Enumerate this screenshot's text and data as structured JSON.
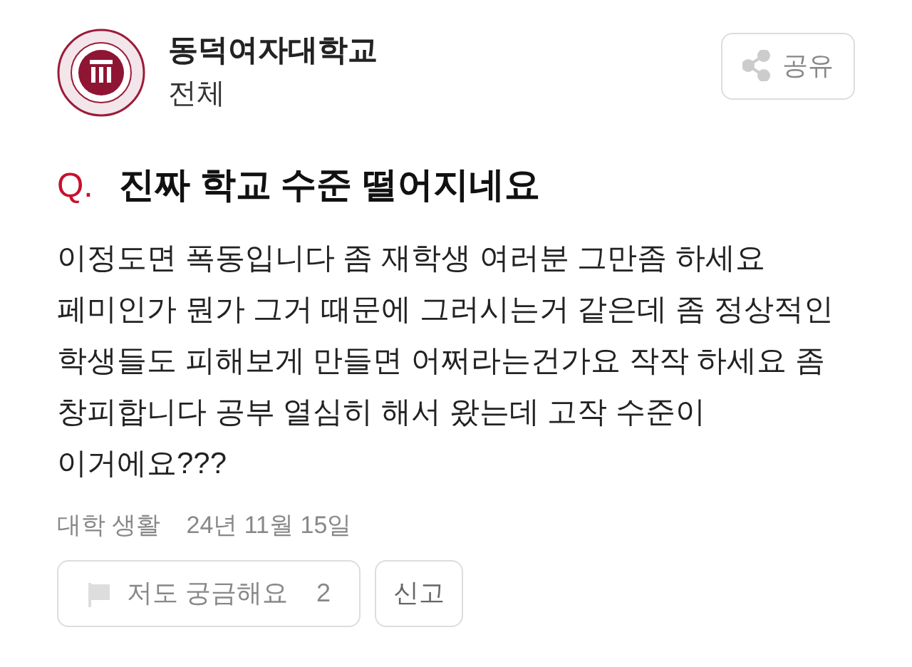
{
  "header": {
    "school": "동덕여자대학교",
    "board": "전체",
    "share_button": "공유"
  },
  "question": {
    "marker": "Q.",
    "title": "진짜 학교 수준 떨어지네요",
    "body": "이정도면 폭동입니다 좀 재학생 여러분 그만좀 하세요 페미인가 뭔가 그거 때문에 그러시는거 같은데 좀 정상적인 학생들도 피해보게 만들면 어쩌라는건가요 작작 하세요 좀 창피합니다 공부 열심히 해서 왔는데 고작 수준이 이거에요???"
  },
  "meta": {
    "category": "대학 생활",
    "date": "24년 11월 15일"
  },
  "actions": {
    "curious_button": {
      "label": "저도 궁금해요",
      "count": "2"
    },
    "report_button": "신고"
  }
}
